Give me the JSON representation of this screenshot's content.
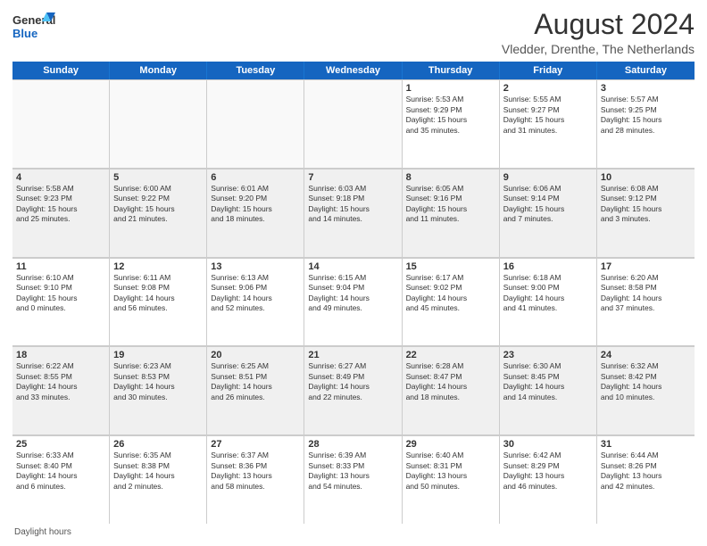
{
  "logo": {
    "general": "General",
    "blue": "Blue"
  },
  "title": "August 2024",
  "subtitle": "Vledder, Drenthe, The Netherlands",
  "weekdays": [
    "Sunday",
    "Monday",
    "Tuesday",
    "Wednesday",
    "Thursday",
    "Friday",
    "Saturday"
  ],
  "footer": "Daylight hours",
  "weeks": [
    [
      {
        "day": "",
        "text": "",
        "empty": true
      },
      {
        "day": "",
        "text": "",
        "empty": true
      },
      {
        "day": "",
        "text": "",
        "empty": true
      },
      {
        "day": "",
        "text": "",
        "empty": true
      },
      {
        "day": "1",
        "text": "Sunrise: 5:53 AM\nSunset: 9:29 PM\nDaylight: 15 hours\nand 35 minutes."
      },
      {
        "day": "2",
        "text": "Sunrise: 5:55 AM\nSunset: 9:27 PM\nDaylight: 15 hours\nand 31 minutes."
      },
      {
        "day": "3",
        "text": "Sunrise: 5:57 AM\nSunset: 9:25 PM\nDaylight: 15 hours\nand 28 minutes."
      }
    ],
    [
      {
        "day": "4",
        "text": "Sunrise: 5:58 AM\nSunset: 9:23 PM\nDaylight: 15 hours\nand 25 minutes."
      },
      {
        "day": "5",
        "text": "Sunrise: 6:00 AM\nSunset: 9:22 PM\nDaylight: 15 hours\nand 21 minutes."
      },
      {
        "day": "6",
        "text": "Sunrise: 6:01 AM\nSunset: 9:20 PM\nDaylight: 15 hours\nand 18 minutes."
      },
      {
        "day": "7",
        "text": "Sunrise: 6:03 AM\nSunset: 9:18 PM\nDaylight: 15 hours\nand 14 minutes."
      },
      {
        "day": "8",
        "text": "Sunrise: 6:05 AM\nSunset: 9:16 PM\nDaylight: 15 hours\nand 11 minutes."
      },
      {
        "day": "9",
        "text": "Sunrise: 6:06 AM\nSunset: 9:14 PM\nDaylight: 15 hours\nand 7 minutes."
      },
      {
        "day": "10",
        "text": "Sunrise: 6:08 AM\nSunset: 9:12 PM\nDaylight: 15 hours\nand 3 minutes."
      }
    ],
    [
      {
        "day": "11",
        "text": "Sunrise: 6:10 AM\nSunset: 9:10 PM\nDaylight: 15 hours\nand 0 minutes."
      },
      {
        "day": "12",
        "text": "Sunrise: 6:11 AM\nSunset: 9:08 PM\nDaylight: 14 hours\nand 56 minutes."
      },
      {
        "day": "13",
        "text": "Sunrise: 6:13 AM\nSunset: 9:06 PM\nDaylight: 14 hours\nand 52 minutes."
      },
      {
        "day": "14",
        "text": "Sunrise: 6:15 AM\nSunset: 9:04 PM\nDaylight: 14 hours\nand 49 minutes."
      },
      {
        "day": "15",
        "text": "Sunrise: 6:17 AM\nSunset: 9:02 PM\nDaylight: 14 hours\nand 45 minutes."
      },
      {
        "day": "16",
        "text": "Sunrise: 6:18 AM\nSunset: 9:00 PM\nDaylight: 14 hours\nand 41 minutes."
      },
      {
        "day": "17",
        "text": "Sunrise: 6:20 AM\nSunset: 8:58 PM\nDaylight: 14 hours\nand 37 minutes."
      }
    ],
    [
      {
        "day": "18",
        "text": "Sunrise: 6:22 AM\nSunset: 8:55 PM\nDaylight: 14 hours\nand 33 minutes."
      },
      {
        "day": "19",
        "text": "Sunrise: 6:23 AM\nSunset: 8:53 PM\nDaylight: 14 hours\nand 30 minutes."
      },
      {
        "day": "20",
        "text": "Sunrise: 6:25 AM\nSunset: 8:51 PM\nDaylight: 14 hours\nand 26 minutes."
      },
      {
        "day": "21",
        "text": "Sunrise: 6:27 AM\nSunset: 8:49 PM\nDaylight: 14 hours\nand 22 minutes."
      },
      {
        "day": "22",
        "text": "Sunrise: 6:28 AM\nSunset: 8:47 PM\nDaylight: 14 hours\nand 18 minutes."
      },
      {
        "day": "23",
        "text": "Sunrise: 6:30 AM\nSunset: 8:45 PM\nDaylight: 14 hours\nand 14 minutes."
      },
      {
        "day": "24",
        "text": "Sunrise: 6:32 AM\nSunset: 8:42 PM\nDaylight: 14 hours\nand 10 minutes."
      }
    ],
    [
      {
        "day": "25",
        "text": "Sunrise: 6:33 AM\nSunset: 8:40 PM\nDaylight: 14 hours\nand 6 minutes."
      },
      {
        "day": "26",
        "text": "Sunrise: 6:35 AM\nSunset: 8:38 PM\nDaylight: 14 hours\nand 2 minutes."
      },
      {
        "day": "27",
        "text": "Sunrise: 6:37 AM\nSunset: 8:36 PM\nDaylight: 13 hours\nand 58 minutes."
      },
      {
        "day": "28",
        "text": "Sunrise: 6:39 AM\nSunset: 8:33 PM\nDaylight: 13 hours\nand 54 minutes."
      },
      {
        "day": "29",
        "text": "Sunrise: 6:40 AM\nSunset: 8:31 PM\nDaylight: 13 hours\nand 50 minutes."
      },
      {
        "day": "30",
        "text": "Sunrise: 6:42 AM\nSunset: 8:29 PM\nDaylight: 13 hours\nand 46 minutes."
      },
      {
        "day": "31",
        "text": "Sunrise: 6:44 AM\nSunset: 8:26 PM\nDaylight: 13 hours\nand 42 minutes."
      }
    ]
  ]
}
